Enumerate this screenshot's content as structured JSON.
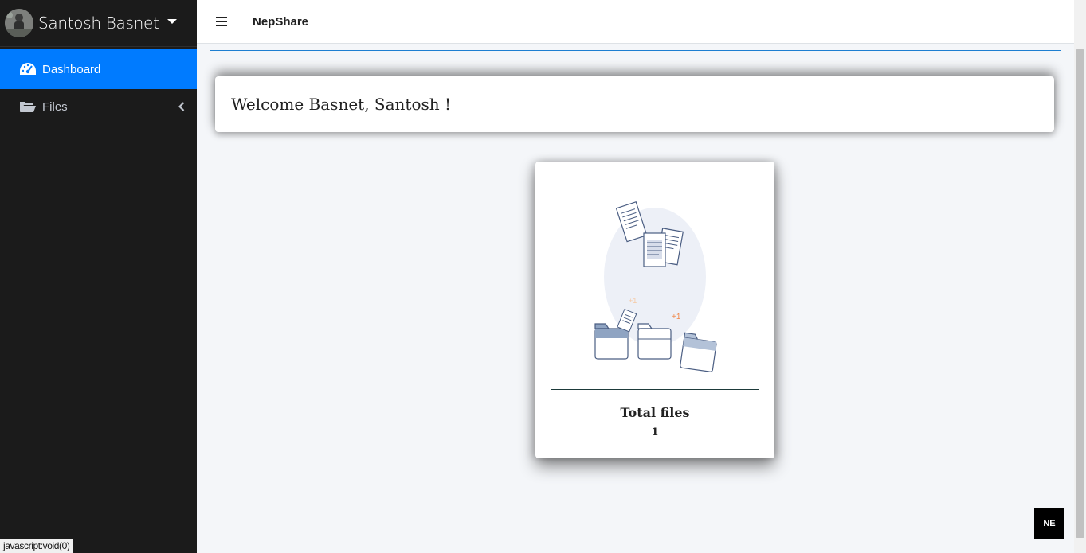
{
  "sidebar": {
    "user": {
      "name": "Santosh Basnet"
    },
    "items": [
      {
        "label": "Dashboard",
        "icon": "tachometer-icon",
        "active": true
      },
      {
        "label": "Files",
        "icon": "folder-open-icon",
        "active": false
      }
    ]
  },
  "topbar": {
    "brand": "NepShare",
    "menu_icon": "hamburger-icon"
  },
  "welcome": {
    "text": "Welcome Basnet, Santosh !"
  },
  "stats_card": {
    "title": "Total files",
    "count": "1",
    "illustration_labels": [
      "+1",
      "+1"
    ]
  },
  "status_bar": {
    "text": "javascript:void(0)"
  },
  "corner_badge": {
    "text": "NE"
  },
  "colors": {
    "sidebar_bg": "#1b1b1b",
    "active_item": "#007bff",
    "accent_line": "#1e7fd1",
    "content_bg": "#f4f6f9"
  }
}
